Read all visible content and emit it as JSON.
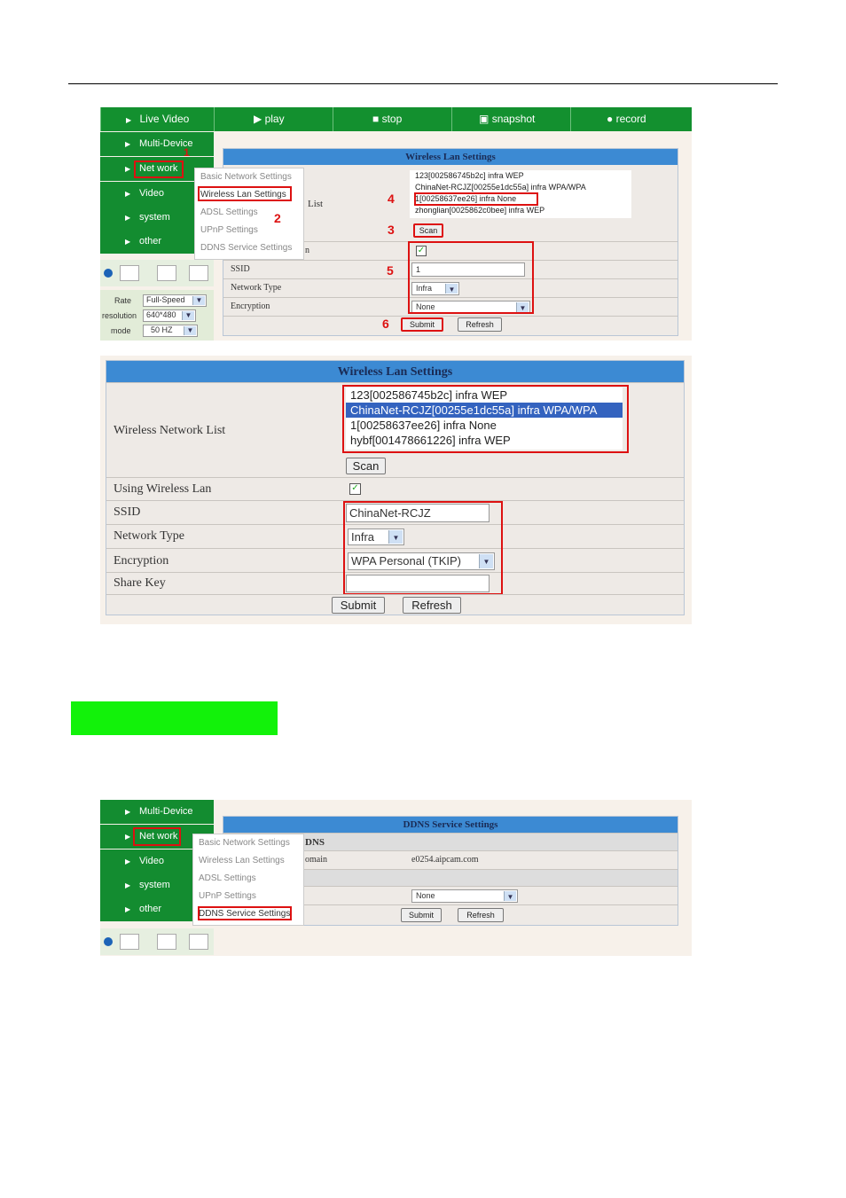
{
  "nav": {
    "live_video": "Live Video",
    "multi_device": "Multi-Device",
    "network": "Net work",
    "video": "Video",
    "system": "system",
    "other": "other"
  },
  "toolbar": {
    "play": "play",
    "stop": "stop",
    "snapshot": "snapshot",
    "record": "record"
  },
  "submenu": [
    "Basic Network Settings",
    "Wireless Lan Settings",
    "ADSL Settings",
    "UPnP Settings",
    "DDNS Service Settings"
  ],
  "settings": {
    "rate_label": "Rate",
    "rate": "Full-Speed",
    "resolution_label": "resolution",
    "resolution": "640*480",
    "mode_label": "mode",
    "mode": "50 HZ"
  },
  "shot1": {
    "title": "Wireless Lan Settings",
    "list_frag": "List",
    "using_frag": "n",
    "ssid_label": "SSID",
    "network_type_label": "Network Type",
    "encryption_label": "Encryption",
    "list": [
      "123[002586745b2c] infra WEP",
      "ChinaNet-RCJZ[00255e1dc55a] infra WPA/WPA",
      "1[00258637ee26] infra None",
      "zhonglian[0025862c0bee] infra WEP"
    ],
    "scan": "Scan",
    "ssid": "1",
    "network_type": "Infra",
    "encryption": "None",
    "submit": "Submit",
    "refresh": "Refresh",
    "steps": [
      "1",
      "2",
      "3",
      "4",
      "5",
      "6"
    ]
  },
  "shot2": {
    "title": "Wireless Lan Settings",
    "network_list_label": "Wireless Network List",
    "list": [
      "123[002586745b2c] infra WEP",
      "ChinaNet-RCJZ[00255e1dc55a] infra WPA/WPA",
      "1[00258637ee26] infra None",
      "hybf[001478661226] infra WEP"
    ],
    "scan": "Scan",
    "using_label": "Using Wireless Lan",
    "ssid_label": "SSID",
    "ssid": "ChinaNet-RCJZ",
    "network_type_label": "Network Type",
    "network_type": "Infra",
    "encryption_label": "Encryption",
    "encryption": "WPA Personal (TKIP)",
    "share_key_label": "Share Key",
    "share_key": "",
    "submit": "Submit",
    "refresh": "Refresh"
  },
  "shot3": {
    "title": "DDNS Service Settings",
    "frag1": "DNS",
    "frag2": "omain",
    "domain": "e0254.aipcam.com",
    "provider": "None",
    "submit": "Submit",
    "refresh": "Refresh"
  },
  "colors": {
    "nav_green": "#138c30",
    "title_blue": "#3c8ad3",
    "highlight": "#12f20a",
    "annotation_red": "#dd1111"
  }
}
